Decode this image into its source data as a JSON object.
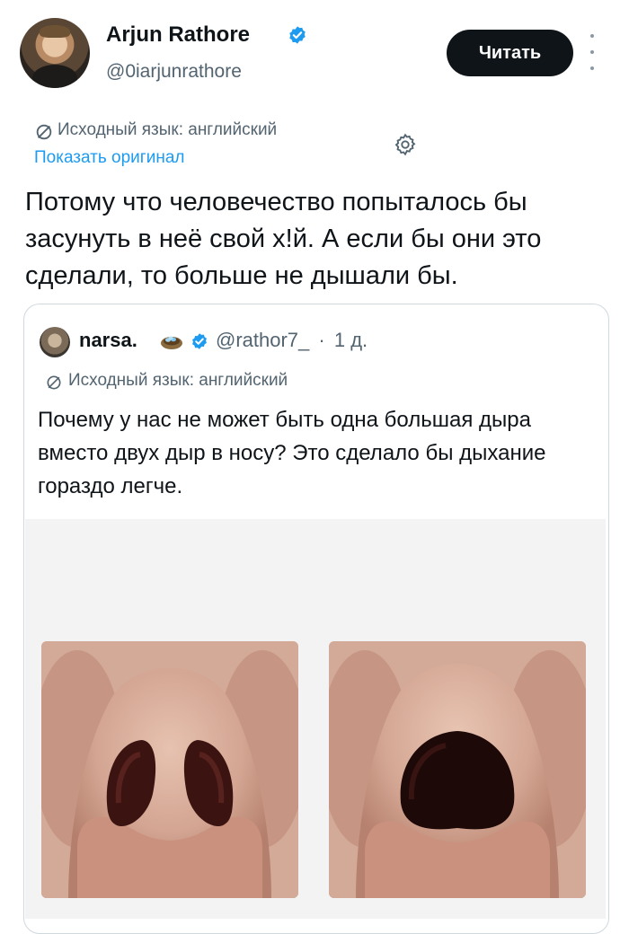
{
  "author": {
    "name": "Arjun Rathore",
    "handle": "@0iarjunrathore",
    "read_button": "Читать"
  },
  "translation": {
    "note": "Исходный язык: английский",
    "show_original": "Показать оригинал"
  },
  "tweet": {
    "text": "Потому что человечество попыталось бы засунуть в неё свой х!й. А если бы они это сделали, то больше не дышали бы."
  },
  "quote": {
    "name": "narsa.",
    "handle": "@rathor7_",
    "separator": "·",
    "time": "1 д.",
    "translation_note": "Исходный язык: английский",
    "text": "Почему у нас не может быть одна большая дыра вместо двух дыр в носу? Это сделало бы дыхание гораздо легче."
  },
  "colors": {
    "verified": "#1d9bf0",
    "link": "#1d9bf0",
    "button_bg": "#0f1419",
    "secondary_text": "#536471"
  },
  "icons": [
    "verified-badge-icon",
    "more-icon",
    "translate-icon",
    "gear-icon"
  ]
}
